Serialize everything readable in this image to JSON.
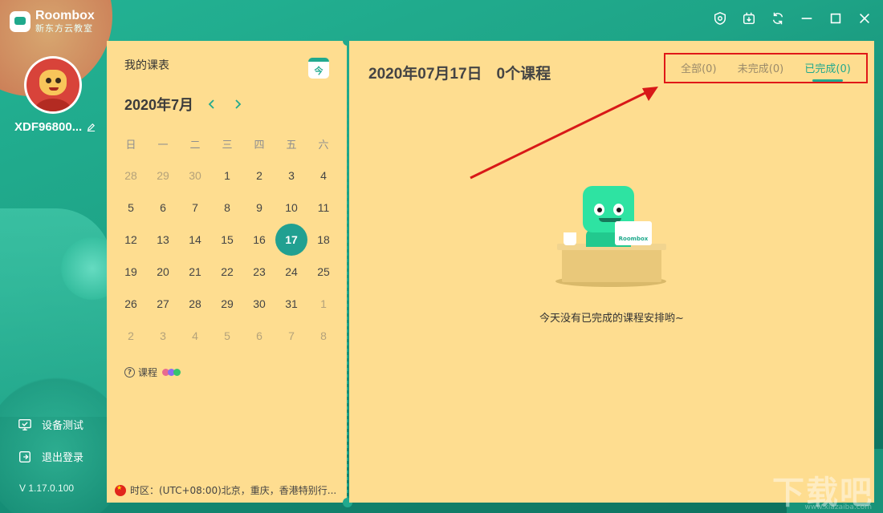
{
  "app": {
    "logo_en": "Roombox",
    "logo_cn": "新东方云教室",
    "accent": "#21a98e",
    "panel_bg": "#fedd90"
  },
  "window_controls": [
    "eye-icon",
    "download-icon",
    "refresh-icon",
    "minimize-icon",
    "maximize-icon",
    "close-icon"
  ],
  "user": {
    "name": "XDF96800...",
    "avatar": "avatar-icon"
  },
  "sidebar": {
    "device_test": "设备测试",
    "logout": "退出登录",
    "version": "V 1.17.0.100"
  },
  "calendar": {
    "title": "我的课表",
    "today_label": "今",
    "month_label": "2020年7月",
    "weekdays": [
      "日",
      "一",
      "二",
      "三",
      "四",
      "五",
      "六"
    ],
    "days": [
      {
        "d": "28",
        "m": true
      },
      {
        "d": "29",
        "m": true
      },
      {
        "d": "30",
        "m": true
      },
      {
        "d": "1"
      },
      {
        "d": "2"
      },
      {
        "d": "3"
      },
      {
        "d": "4"
      },
      {
        "d": "5"
      },
      {
        "d": "6"
      },
      {
        "d": "7"
      },
      {
        "d": "8"
      },
      {
        "d": "9"
      },
      {
        "d": "10"
      },
      {
        "d": "11"
      },
      {
        "d": "12"
      },
      {
        "d": "13"
      },
      {
        "d": "14"
      },
      {
        "d": "15"
      },
      {
        "d": "16"
      },
      {
        "d": "17",
        "s": true
      },
      {
        "d": "18"
      },
      {
        "d": "19"
      },
      {
        "d": "20"
      },
      {
        "d": "21"
      },
      {
        "d": "22"
      },
      {
        "d": "23"
      },
      {
        "d": "24"
      },
      {
        "d": "25"
      },
      {
        "d": "26"
      },
      {
        "d": "27"
      },
      {
        "d": "28"
      },
      {
        "d": "29"
      },
      {
        "d": "30"
      },
      {
        "d": "31"
      },
      {
        "d": "1",
        "m": true
      },
      {
        "d": "2",
        "m": true
      },
      {
        "d": "3",
        "m": true
      },
      {
        "d": "4",
        "m": true
      },
      {
        "d": "5",
        "m": true
      },
      {
        "d": "6",
        "m": true
      },
      {
        "d": "7",
        "m": true
      },
      {
        "d": "8",
        "m": true
      }
    ],
    "legend_label": "课程",
    "legend_colors": [
      "#e86a8f",
      "#8a6cf0",
      "#35c46d"
    ],
    "timezone": "时区：(UTC+08:00)北京，重庆，香港特别行..."
  },
  "main": {
    "date": "2020年07月17日",
    "course_count": "0个课程",
    "tabs": [
      {
        "label": "全部(0)",
        "active": false
      },
      {
        "label": "未完成(0)",
        "active": false
      },
      {
        "label": "已完成(0)",
        "active": true
      }
    ],
    "empty_message": "今天没有已完成的课程安排哟~",
    "illustration_label": "Roombox"
  },
  "watermark": {
    "text": "下载吧",
    "sub": "www.xiazaiba.com"
  }
}
